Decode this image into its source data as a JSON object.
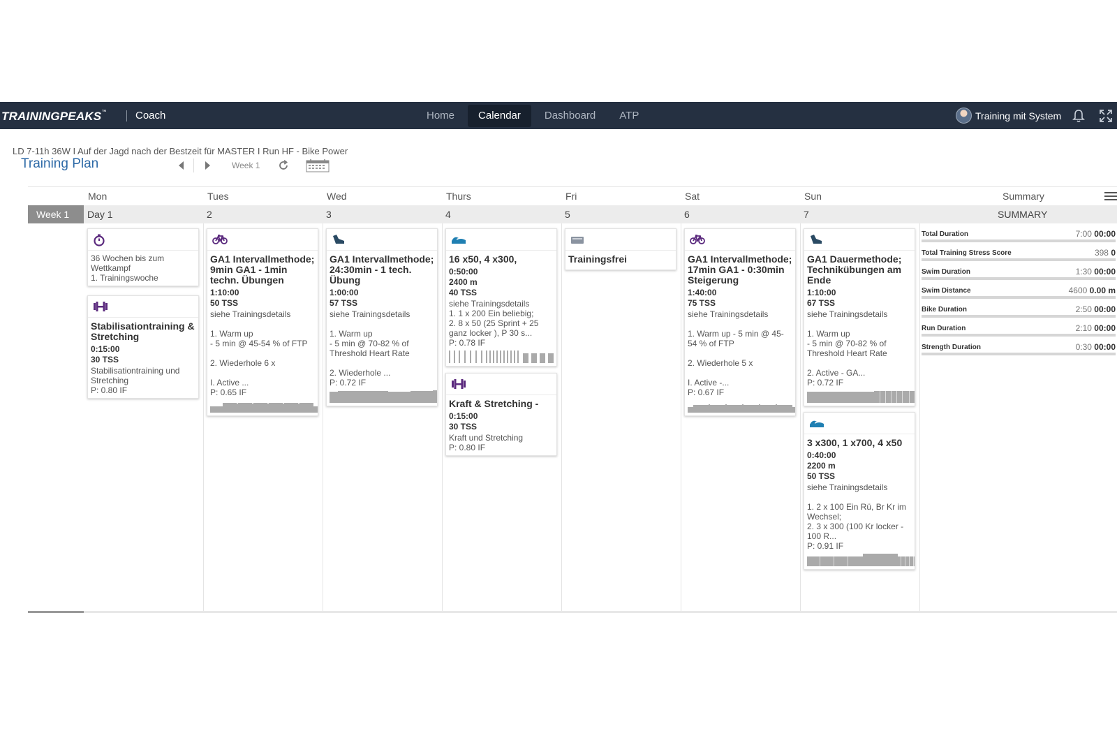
{
  "navbar": {
    "brand": "TRAININGPEAKS",
    "brand_tm": "™",
    "product": "Coach",
    "tabs": [
      {
        "label": "Home",
        "active": false
      },
      {
        "label": "Calendar",
        "active": true
      },
      {
        "label": "Dashboard",
        "active": false
      },
      {
        "label": "ATP",
        "active": false
      }
    ],
    "user_name": "Training mit System",
    "icons": [
      "user-avatar",
      "bell-icon",
      "fullscreen-icon"
    ]
  },
  "plan": {
    "subtitle": "LD 7-11h 36W I Auf der Jagd nach der Bestzeit für MASTER I Run HF - Bike Power",
    "title": "Training Plan",
    "week_label": "Week 1"
  },
  "calendar": {
    "day_names": [
      "Mon",
      "Tues",
      "Wed",
      "Thurs",
      "Fri",
      "Sat",
      "Sun"
    ],
    "summary_header": "Summary",
    "week_tab": "Week 1",
    "day_numbers": [
      "Day 1",
      "2",
      "3",
      "4",
      "5",
      "6",
      "7"
    ],
    "summary_label": "SUMMARY"
  },
  "cards": {
    "mon_event": {
      "icon": "stopwatch-icon",
      "text": "36 Wochen bis zum Wettkampf\n1. Trainingswoche"
    },
    "mon_strength": {
      "icon": "dumbbell-icon",
      "title": "Stabilisationtraining & Stretching",
      "duration": "0:15:00",
      "tss": "30 TSS",
      "text": "Stabilisationtraining und Stretching",
      "if": "P: 0.80 IF"
    },
    "tue_bike": {
      "icon": "bike-icon",
      "title": "GA1 Intervallmethode; 9min GA1 - 1min techn. Übungen",
      "duration": "1:10:00",
      "tss": "50 TSS",
      "text": "siehe Trainingsdetails\n\n1. Warm up\n- 5 min @ 45-54 % of FTP\n\n2. Wiederhole 6 x\n\nI. Active ...",
      "if": "P: 0.65 IF"
    },
    "wed_run": {
      "icon": "run-shoe-icon",
      "title": "GA1 Intervallmethode; 24:30min - 1 tech. Übung",
      "duration": "1:00:00",
      "tss": "57 TSS",
      "text": "siehe Trainingsdetails\n\n1. Warm up\n- 5 min @ 70-82 % of Threshold Heart Rate\n\n2. Wiederhole ...",
      "if": "P: 0.72 IF"
    },
    "thu_swim": {
      "icon": "swim-icon",
      "title": "16 x50, 4 x300,",
      "duration": "0:50:00",
      "distance": "2400 m",
      "tss": "40 TSS",
      "text": "siehe Trainingsdetails\n1. 1 x 200 Ein beliebig;\n2. 8 x 50 (25 Sprint + 25 ganz locker ), P 30 s...",
      "if": "P: 0.78 IF"
    },
    "thu_strength": {
      "icon": "dumbbell-icon",
      "title": "Kraft & Stretching -",
      "duration": "0:15:00",
      "tss": "30 TSS",
      "text": "Kraft und Stretching",
      "if": "P: 0.80 IF"
    },
    "fri_off": {
      "icon": "day-off-icon",
      "title": "Trainingsfrei"
    },
    "sat_bike": {
      "icon": "bike-icon",
      "title": "GA1 Intervallmethode; 17min GA1 - 0:30min Steigerung",
      "duration": "1:40:00",
      "tss": "75 TSS",
      "text": "siehe Trainingsdetails\n\n1. Warm up - 5 min @ 45-54 % of FTP\n\n2. Wiederhole 5 x\n\nI. Active -...",
      "if": "P: 0.67 IF"
    },
    "sun_run": {
      "icon": "run-shoe-icon",
      "title": "GA1 Dauermethode; Technikübungen am Ende",
      "duration": "1:10:00",
      "tss": "67 TSS",
      "text": "siehe Trainingsdetails\n\n1. Warm up\n- 5 min @ 70-82 % of Threshold Heart Rate\n\n2. Active - GA...",
      "if": "P: 0.72 IF"
    },
    "sun_swim": {
      "icon": "swim-icon",
      "title": "3 x300, 1 x700, 4 x50",
      "duration": "0:40:00",
      "distance": "2200 m",
      "tss": "50 TSS",
      "text": "siehe Trainingsdetails\n\n1. 2 x 100 Ein Rü, Br Kr im Wechsel;\n2. 3 x 300 (100 Kr locker - 100 R...",
      "if": "P: 0.91 IF"
    }
  },
  "summary": [
    {
      "label": "Total Duration",
      "planned": "7:00",
      "actual": "00:00"
    },
    {
      "label": "Total Training Stress Score",
      "planned": "398",
      "actual": "0"
    },
    {
      "label": "Swim Duration",
      "planned": "1:30",
      "actual": "00:00"
    },
    {
      "label": "Swim Distance",
      "planned": "4600",
      "actual": "0.00 m"
    },
    {
      "label": "Bike Duration",
      "planned": "2:50",
      "actual": "00:00"
    },
    {
      "label": "Run Duration",
      "planned": "2:10",
      "actual": "00:00"
    },
    {
      "label": "Strength Duration",
      "planned": "0:30",
      "actual": "00:00"
    }
  ],
  "colors": {
    "navbar": "#253041",
    "strength_purple": "#5b2a7e",
    "swim_blue": "#1f7fb2",
    "run_navy": "#2a4a63",
    "title_blue": "#2e6aa7"
  }
}
